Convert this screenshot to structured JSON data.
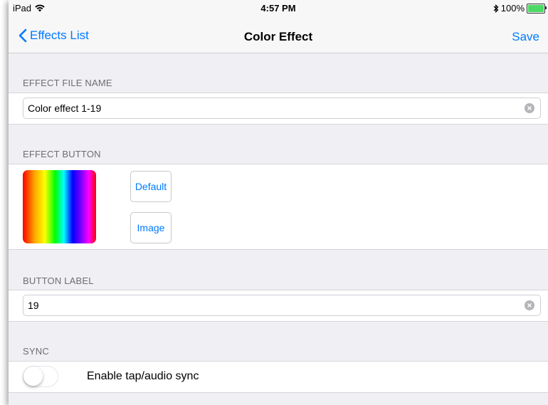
{
  "status_bar": {
    "device": "iPad",
    "time": "4:57 PM",
    "battery": "100%",
    "battery_level": 1.0,
    "icons": [
      "wifi-icon",
      "bluetooth-icon",
      "battery-icon"
    ]
  },
  "nav": {
    "back_label": "Effects List",
    "title": "Color Effect",
    "save_label": "Save"
  },
  "file_name_section": {
    "header": "EFFECT FILE NAME",
    "value": "Color effect 1-19",
    "placeholder": ""
  },
  "button_section": {
    "header": "EFFECT BUTTON",
    "default_label": "Default",
    "image_label": "Image"
  },
  "label_section": {
    "header": "BUTTON LABEL",
    "value": "19",
    "placeholder": ""
  },
  "sync_section": {
    "header": "SYNC",
    "toggle_label": "Enable tap/audio sync",
    "enabled": false
  },
  "colors": {
    "accent": "#007aff",
    "background": "#efeff4",
    "header_text": "#6d6d72",
    "battery": "#4cd964"
  }
}
